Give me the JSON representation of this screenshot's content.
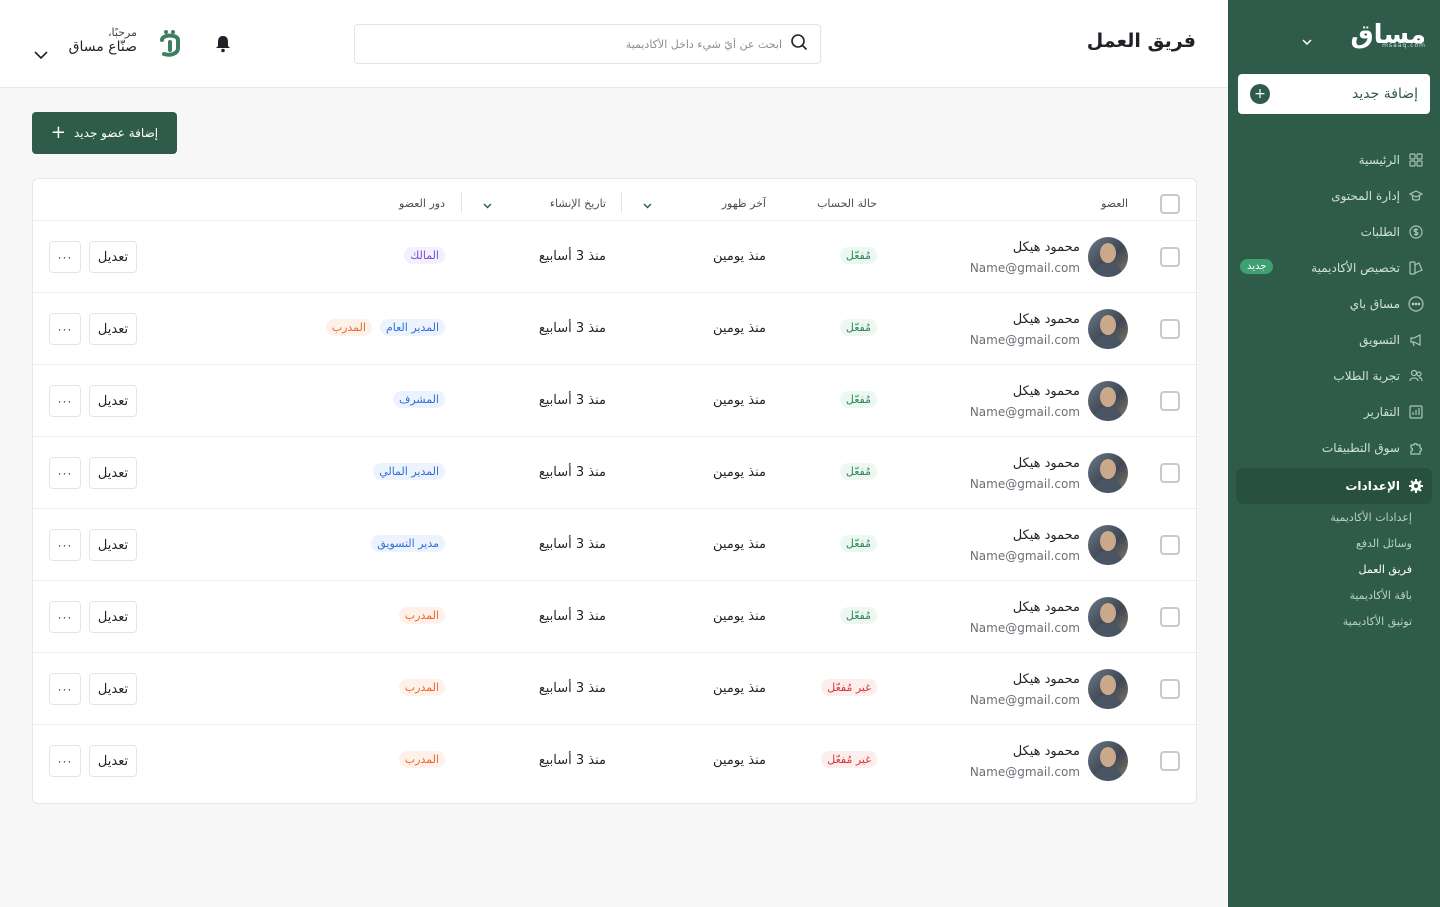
{
  "sidebar": {
    "brand": "مساق",
    "brand_sub": "msaaq.com",
    "add_new": "إضافة جديد",
    "items": [
      {
        "label": "الرئيسية",
        "icon": "grid-icon"
      },
      {
        "label": "إدارة المحتوى",
        "icon": "graduation-cap-icon"
      },
      {
        "label": "الطلبات",
        "icon": "dollar-icon"
      },
      {
        "label": "تخصيص الأكاديمية",
        "icon": "palette-icon",
        "badge": "جديد"
      },
      {
        "label": "مساق باي",
        "icon": "pay-icon"
      },
      {
        "label": "التسويق",
        "icon": "megaphone-icon"
      },
      {
        "label": "تجربة الطلاب",
        "icon": "users-icon"
      },
      {
        "label": "التقارير",
        "icon": "chart-icon"
      },
      {
        "label": "سوق التطبيقات",
        "icon": "puzzle-icon"
      },
      {
        "label": "الإعدادات",
        "icon": "gear-icon"
      }
    ],
    "sub_items": [
      "إعدادات الأكاديمية",
      "وسائل الدفع",
      "فريق العمل",
      "باقة الأكاديمية",
      "توثيق الأكاديمية"
    ]
  },
  "header": {
    "title": "فريق العمل",
    "search_placeholder": "ابحث عن أيّ شيء داخل الأكاديمية",
    "greeting": "مرحبًا،",
    "user_name": "صنّاع مساق"
  },
  "main": {
    "add_member": "إضافة عضو جديد",
    "columns": {
      "member": "العضو",
      "status": "حالة الحساب",
      "last_seen": "آخر ظهور",
      "created": "تاريخ الإنشاء",
      "role": "دور العضو"
    },
    "edit_label": "تعديل",
    "more_label": "···",
    "rows": [
      {
        "name": "محمود هيكل",
        "email": "Name@gmail.com",
        "status": "مُفعّل",
        "active": true,
        "last_seen": "منذ يومين",
        "created": "منذ 3 أسابيع",
        "roles": [
          {
            "label": "المالك",
            "color": "purple"
          }
        ]
      },
      {
        "name": "محمود هيكل",
        "email": "Name@gmail.com",
        "status": "مُفعّل",
        "active": true,
        "last_seen": "منذ يومين",
        "created": "منذ 3 أسابيع",
        "roles": [
          {
            "label": "المدير العام",
            "color": "blue"
          },
          {
            "label": "المدرب",
            "color": "orange"
          }
        ]
      },
      {
        "name": "محمود هيكل",
        "email": "Name@gmail.com",
        "status": "مُفعّل",
        "active": true,
        "last_seen": "منذ يومين",
        "created": "منذ 3 أسابيع",
        "roles": [
          {
            "label": "المشرف",
            "color": "blue"
          }
        ]
      },
      {
        "name": "محمود هيكل",
        "email": "Name@gmail.com",
        "status": "مُفعّل",
        "active": true,
        "last_seen": "منذ يومين",
        "created": "منذ 3 أسابيع",
        "roles": [
          {
            "label": "المدير المالي",
            "color": "blue"
          }
        ]
      },
      {
        "name": "محمود هيكل",
        "email": "Name@gmail.com",
        "status": "مُفعّل",
        "active": true,
        "last_seen": "منذ يومين",
        "created": "منذ 3 أسابيع",
        "roles": [
          {
            "label": "مدير التسويق",
            "color": "blue"
          }
        ]
      },
      {
        "name": "محمود هيكل",
        "email": "Name@gmail.com",
        "status": "مُفعّل",
        "active": true,
        "last_seen": "منذ يومين",
        "created": "منذ 3 أسابيع",
        "roles": [
          {
            "label": "المدرب",
            "color": "orange"
          }
        ]
      },
      {
        "name": "محمود هيكل",
        "email": "Name@gmail.com",
        "status": "غير مُفعّل",
        "active": false,
        "last_seen": "منذ يومين",
        "created": "منذ 3 أسابيع",
        "roles": [
          {
            "label": "المدرب",
            "color": "orange"
          }
        ]
      },
      {
        "name": "محمود هيكل",
        "email": "Name@gmail.com",
        "status": "غير مُفعّل",
        "active": false,
        "last_seen": "منذ يومين",
        "created": "منذ 3 أسابيع",
        "roles": [
          {
            "label": "المدرب",
            "color": "orange"
          }
        ]
      }
    ]
  },
  "colors": {
    "brand": "#2f5c4a",
    "active_status": "#2c8a57",
    "inactive_status": "#d23b3b"
  }
}
